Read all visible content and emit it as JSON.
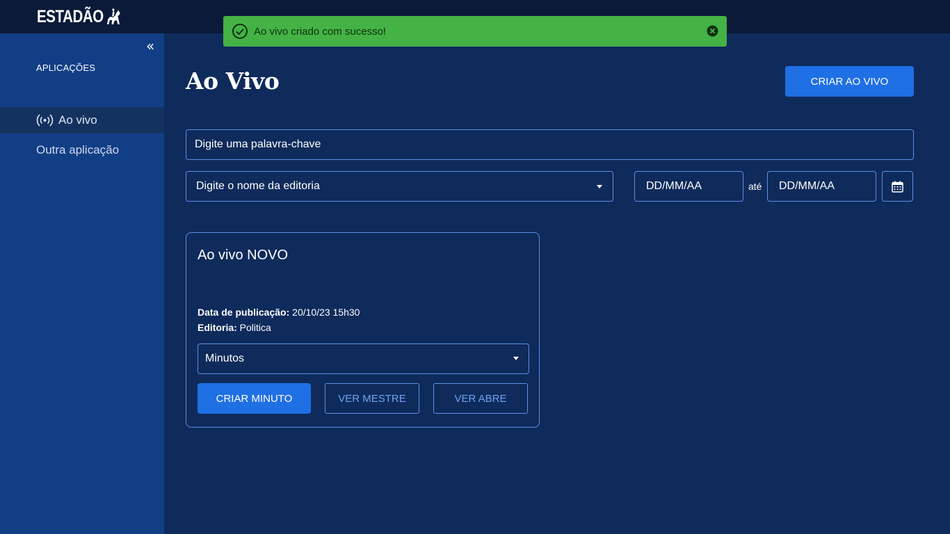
{
  "header": {
    "logo_text": "ESTADÃO"
  },
  "toast": {
    "message": "Ao vivo criado com sucesso!",
    "color": "#44b244"
  },
  "sidebar": {
    "collapse_label": "«",
    "section_label": "APLICAÇÕES",
    "items": [
      {
        "label": "Ao vivo",
        "icon": "broadcast-icon",
        "active": true
      },
      {
        "label": "Outra aplicação",
        "active": false
      }
    ]
  },
  "main": {
    "title": "Ao Vivo",
    "create_button": "CRIAR AO VIVO",
    "filters": {
      "keyword_placeholder": "Digite uma palavra-chave",
      "editoria_placeholder": "Digite o nome da editoria",
      "date_from_placeholder": "DD/MM/AA",
      "date_separator": "até",
      "date_to_placeholder": "DD/MM/AA"
    },
    "card": {
      "title": "Ao vivo NOVO",
      "pub_label": "Data de publicação:",
      "pub_value": "20/10/23 15h30",
      "editoria_label": "Editoria:",
      "editoria_value": "Politica",
      "select_value": "Minutos",
      "buttons": {
        "criar_minuto": "CRIAR MINUTO",
        "ver_mestre": "VER MESTRE",
        "ver_abre": "VER ABRE"
      }
    }
  },
  "colors": {
    "background": "#0f2b5b",
    "sidebar": "#123e86",
    "topbar": "#0b1a38",
    "accent": "#1f6fe5",
    "border": "#5d8fe6"
  }
}
